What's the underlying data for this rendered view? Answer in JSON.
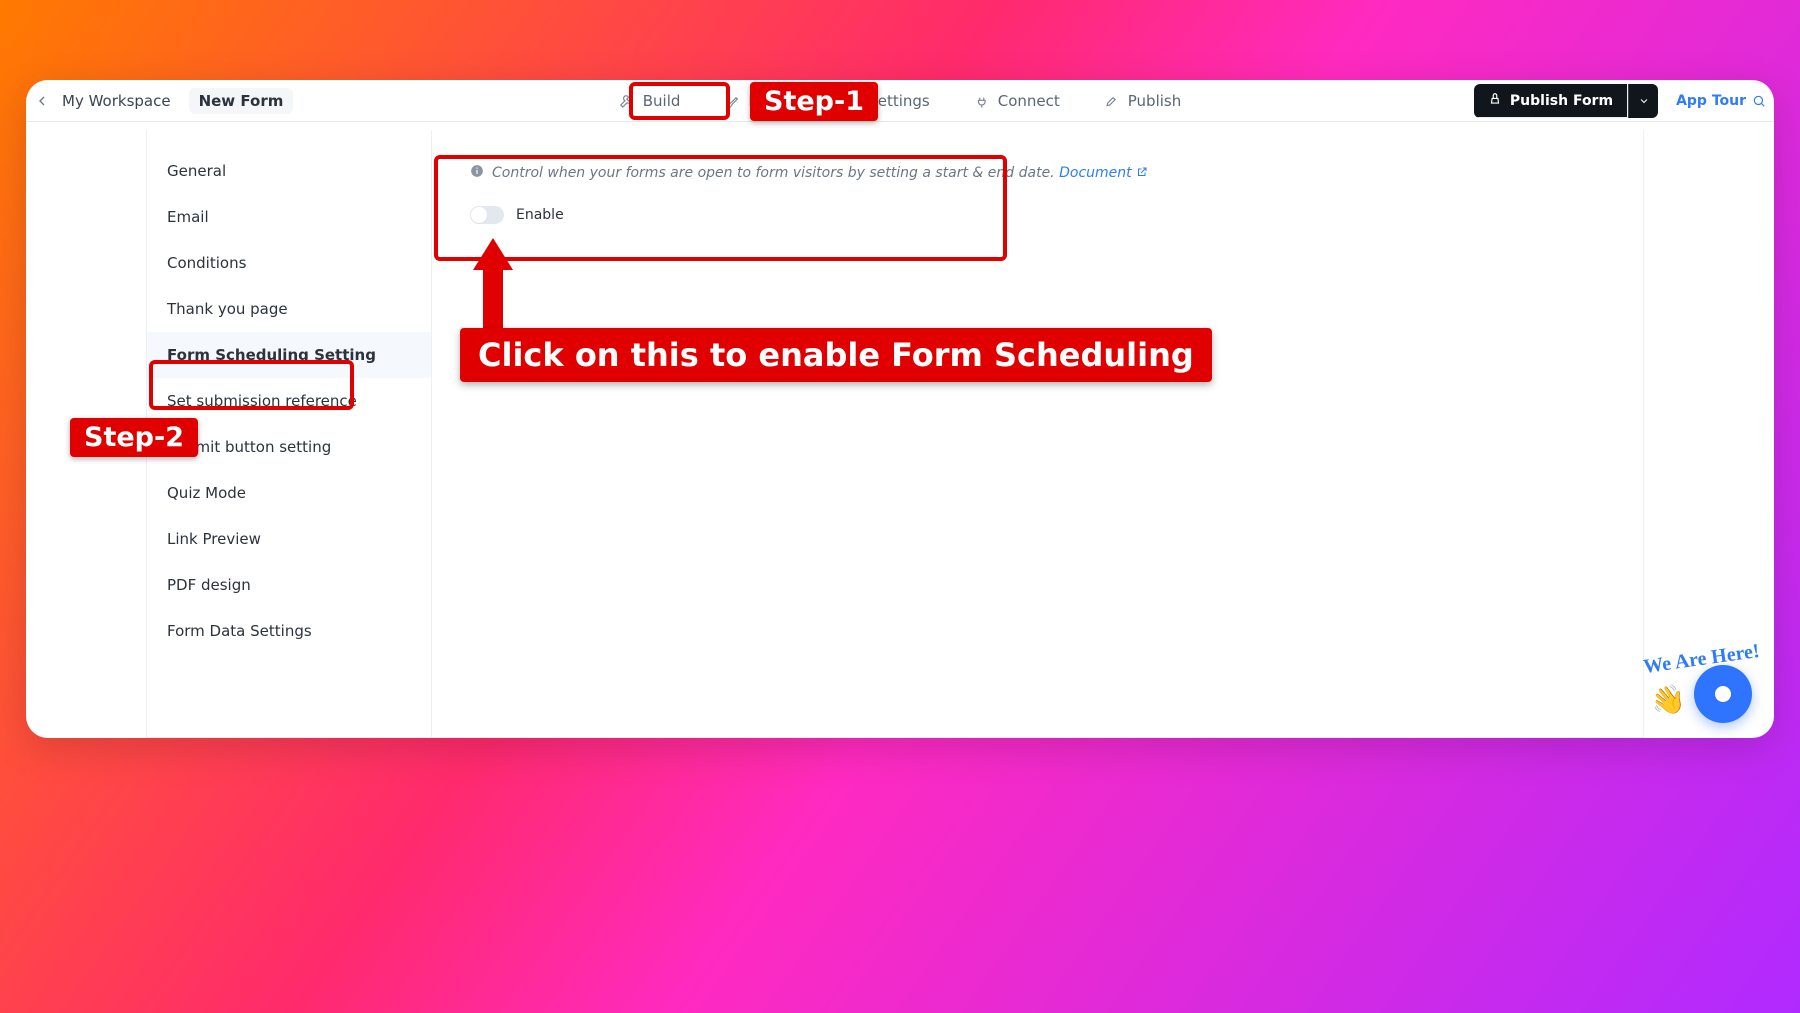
{
  "breadcrumb": {
    "workspace": "My Workspace",
    "form": "New Form"
  },
  "tabs": {
    "build": "Build",
    "design": "Design",
    "settings": "Settings",
    "connect": "Connect",
    "publish": "Publish"
  },
  "actions": {
    "publish_form": "Publish Form",
    "app_tour": "App Tour"
  },
  "sidebar": {
    "items": [
      "General",
      "Email",
      "Conditions",
      "Thank you page",
      "Form Scheduling Setting",
      "Set submission reference",
      "Submit button setting",
      "Quiz Mode",
      "Link Preview",
      "PDF design",
      "Form Data Settings"
    ],
    "active_index": 4
  },
  "content": {
    "info_text": "Control when your forms are open to form visitors by setting a start & end date.",
    "doc_link": "Document",
    "enable_label": "Enable"
  },
  "annotations": {
    "step1": "Step-1",
    "step2": "Step-2",
    "callout": "Click on this to enable Form Scheduling"
  },
  "widget": {
    "badge": "We Are Here!"
  }
}
